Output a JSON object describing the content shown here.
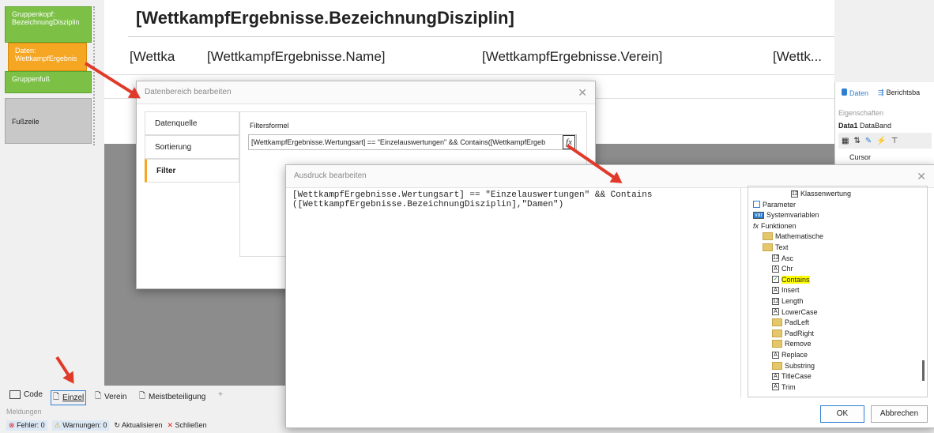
{
  "bands": {
    "group_header": "Gruppenkopf: BezeichnungDisziplin",
    "data": "Daten: WettkampfErgebnis",
    "group_footer": "Gruppenfuß",
    "footer": "Fußzeile"
  },
  "report": {
    "header_field": "[WettkampfErgebnisse.BezeichnungDisziplin]",
    "field1": "[Wettka",
    "field2": "[WettkampfErgebnisse.Name]",
    "field3": "[WettkampfErgebnisse.Verein]",
    "field4": "[Wettk..."
  },
  "right_panel": {
    "tab_data": "Daten",
    "tab_report": "Berichtsba",
    "properties": "Eigenschaften",
    "object_name": "Data1",
    "object_type": "DataBand",
    "cursor_label": "Cursor"
  },
  "dlg1": {
    "title": "Datenbereich bearbeiten",
    "nav": [
      "Datenquelle",
      "Sortierung",
      "Filter"
    ],
    "filter_label": "Filtersformel",
    "filter_value": "[WettkampfErgebnisse.Wertungsart] == \"Einzelauswertungen\" && Contains([WettkampfErgeb",
    "fx": "fx"
  },
  "dlg2": {
    "title": "Ausdruck bearbeiten",
    "expr_line1": "[WettkampfErgebnisse.Wertungsart] == \"Einzelauswertungen\" && Contains",
    "expr_line2": "([WettkampfErgebnisse.BezeichnungDisziplin],\"Damen\")",
    "ok": "OK",
    "cancel": "Abbrechen",
    "tree": [
      {
        "label": "Klassenwertung",
        "icon": "12",
        "indent": 4
      },
      {
        "label": "Parameter",
        "icon": "param",
        "indent": 0
      },
      {
        "label": "Systemvariablen",
        "icon": "var",
        "indent": 0
      },
      {
        "label": "Funktionen",
        "icon": "fx",
        "indent": 0
      },
      {
        "label": "Mathematische",
        "icon": "folder",
        "indent": 1
      },
      {
        "label": "Text",
        "icon": "folder",
        "indent": 1
      },
      {
        "label": "Asc",
        "icon": "12",
        "indent": 2
      },
      {
        "label": "Chr",
        "icon": "A",
        "indent": 2
      },
      {
        "label": "Contains",
        "icon": "check",
        "indent": 2
      },
      {
        "label": "Insert",
        "icon": "A",
        "indent": 2
      },
      {
        "label": "Length",
        "icon": "12",
        "indent": 2
      },
      {
        "label": "LowerCase",
        "icon": "A",
        "indent": 2
      },
      {
        "label": "PadLeft",
        "icon": "folder",
        "indent": 2
      },
      {
        "label": "PadRight",
        "icon": "folder",
        "indent": 2
      },
      {
        "label": "Remove",
        "icon": "folder",
        "indent": 2
      },
      {
        "label": "Replace",
        "icon": "A",
        "indent": 2
      },
      {
        "label": "Substring",
        "icon": "folder",
        "indent": 2
      },
      {
        "label": "TitleCase",
        "icon": "A",
        "indent": 2
      },
      {
        "label": "Trim",
        "icon": "A",
        "indent": 2
      }
    ],
    "icon_texts": {
      "12": "12",
      "A": "A",
      "var": "var",
      "fx": "fx"
    },
    "highlight_color": "#ffff00"
  },
  "bottom_tabs": [
    "Code",
    "Einzel",
    "Verein",
    "Meistbeteiligung",
    "+"
  ],
  "messages": {
    "title": "Meldungen",
    "errors": "Fehler: 0",
    "warnings": "Warnungen: 0",
    "refresh": "Aktualisieren",
    "close": "Schließen"
  },
  "colors": {
    "accent": "#f5a623",
    "green": "#7cc146",
    "arrow": "#e03a2a"
  }
}
